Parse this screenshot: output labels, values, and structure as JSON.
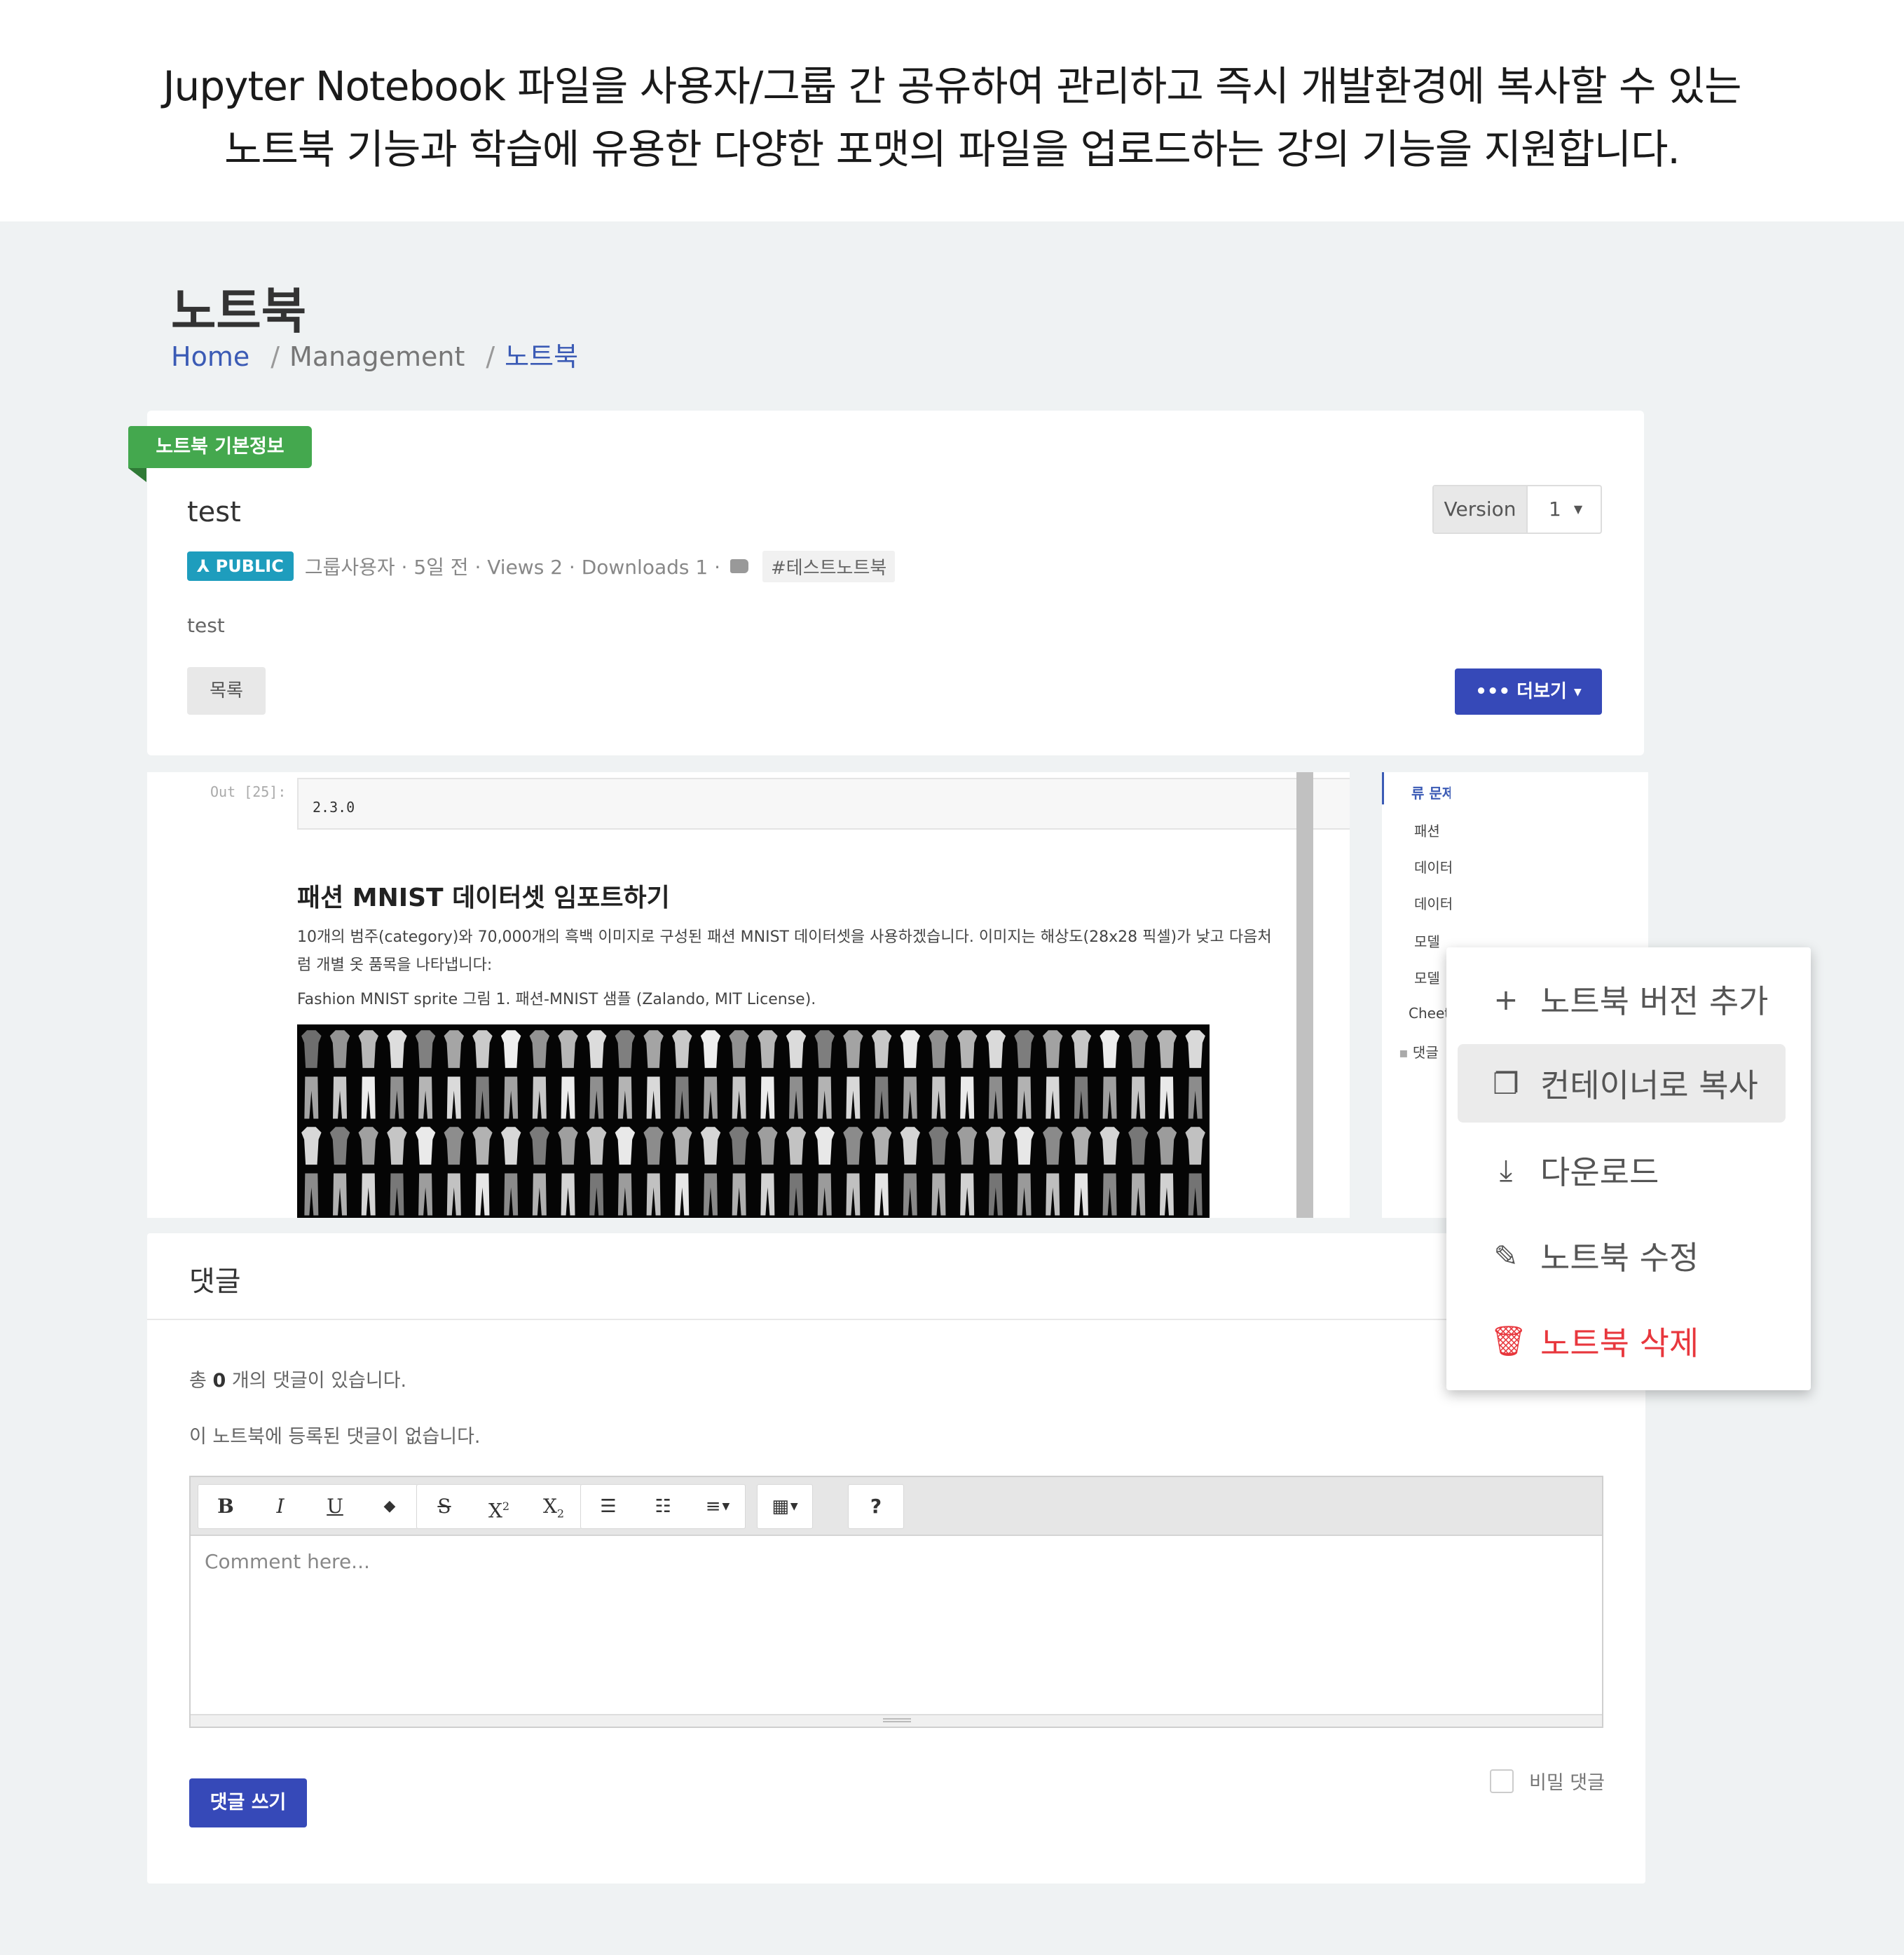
{
  "caption": {
    "line1": "Jupyter Notebook 파일을 사용자/그룹 간 공유하여 관리하고 즉시 개발환경에 복사할 수 있는",
    "line2": "노트북 기능과 학습에 유용한 다양한 포맷의 파일을 업로드하는 강의 기능을 지원합니다."
  },
  "header": {
    "title": "노트북",
    "breadcrumb": [
      "Home",
      "Management",
      "노트북"
    ]
  },
  "info": {
    "ribbon": "노트북 기본정보",
    "name": "test",
    "version_label": "Version",
    "version_value": "1",
    "visibility": "PUBLIC",
    "meta": "그룹사용자 · 5일 전 · Views 2 · Downloads 1 ·",
    "tag": "#테스트노트북",
    "description": "test",
    "list_button": "목록",
    "more_button": "더보기"
  },
  "notebook": {
    "out_label": "Out [25]:",
    "out_value": "2.3.0",
    "heading": "패션 MNIST 데이터셋 임포트하기",
    "paragraph": "10개의 범주(category)와 70,000개의 흑백 이미지로 구성된 패션 MNIST 데이터셋을 사용하겠습니다. 이미지는 해상도(28x28 픽셀)가 낮고 다음처럼 개별 옷 품목을 나타냅니다:",
    "figure_caption": "Fashion MNIST sprite 그림 1. 패션-MNIST 샘플 (Zalando, MIT License)."
  },
  "toc": {
    "items": [
      "류 문제",
      "패션",
      "데이터",
      "데이터",
      "모델",
      "모델",
      "Cheet",
      "댓글"
    ]
  },
  "dropdown": {
    "items": [
      {
        "icon": "plus-icon",
        "label": "노트북 버전 추가"
      },
      {
        "icon": "copy-icon",
        "label": "컨테이너로 복사"
      },
      {
        "icon": "download-icon",
        "label": "다운로드"
      },
      {
        "icon": "pencil-icon",
        "label": "노트북 수정"
      },
      {
        "icon": "trash-icon",
        "label": "노트북 삭제"
      }
    ]
  },
  "comments": {
    "title": "댓글",
    "count_prefix": "총",
    "count": "0",
    "count_suffix": "개의 댓글이 있습니다.",
    "empty": "이 노트북에 등록된 댓글이 없습니다.",
    "placeholder": "Comment here...",
    "submit": "댓글 쓰기",
    "secret": "비밀 댓글"
  },
  "colors": {
    "primary": "#3649b8",
    "ribbon": "#44a84e",
    "public_badge": "#1e9dbd",
    "danger": "#e8373d",
    "link": "#3b5bb5"
  }
}
